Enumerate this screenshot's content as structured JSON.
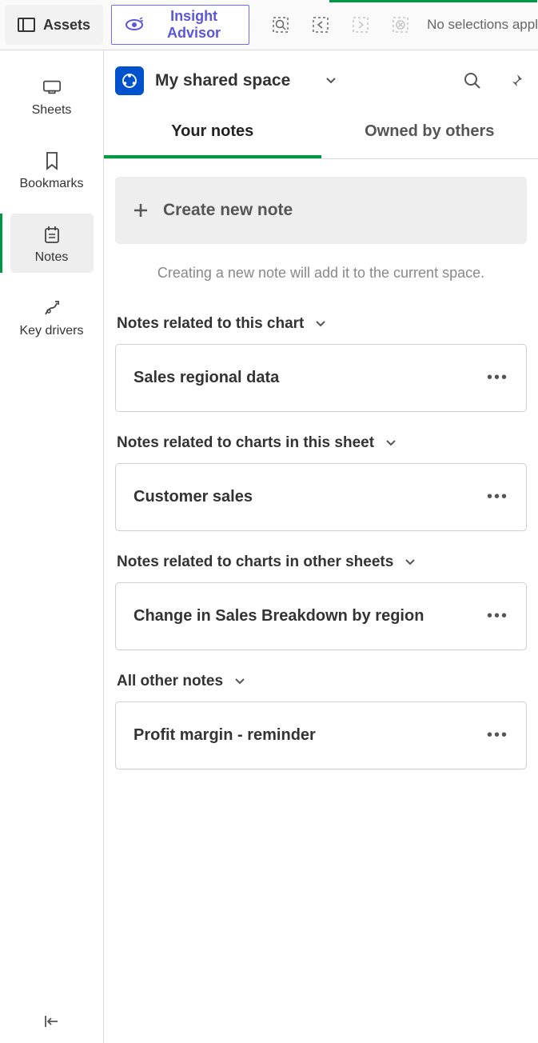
{
  "topbar": {
    "assets": "Assets",
    "insight": "Insight Advisor",
    "no_selections": "No selections appl"
  },
  "vnav": {
    "sheets": "Sheets",
    "bookmarks": "Bookmarks",
    "notes": "Notes",
    "keydrivers": "Key drivers"
  },
  "panel": {
    "space": "My shared space",
    "tabs": {
      "your": "Your notes",
      "others": "Owned by others"
    },
    "create": "Create new note",
    "hint": "Creating a new note will add it to the current space."
  },
  "sections": {
    "s1": {
      "title": "Notes related to this chart",
      "note": "Sales regional data"
    },
    "s2": {
      "title": "Notes related to charts in this sheet",
      "note": "Customer sales"
    },
    "s3": {
      "title": "Notes related to charts in other sheets",
      "note": "Change in Sales Breakdown by region"
    },
    "s4": {
      "title": "All other notes",
      "note": "Profit margin - reminder"
    }
  }
}
